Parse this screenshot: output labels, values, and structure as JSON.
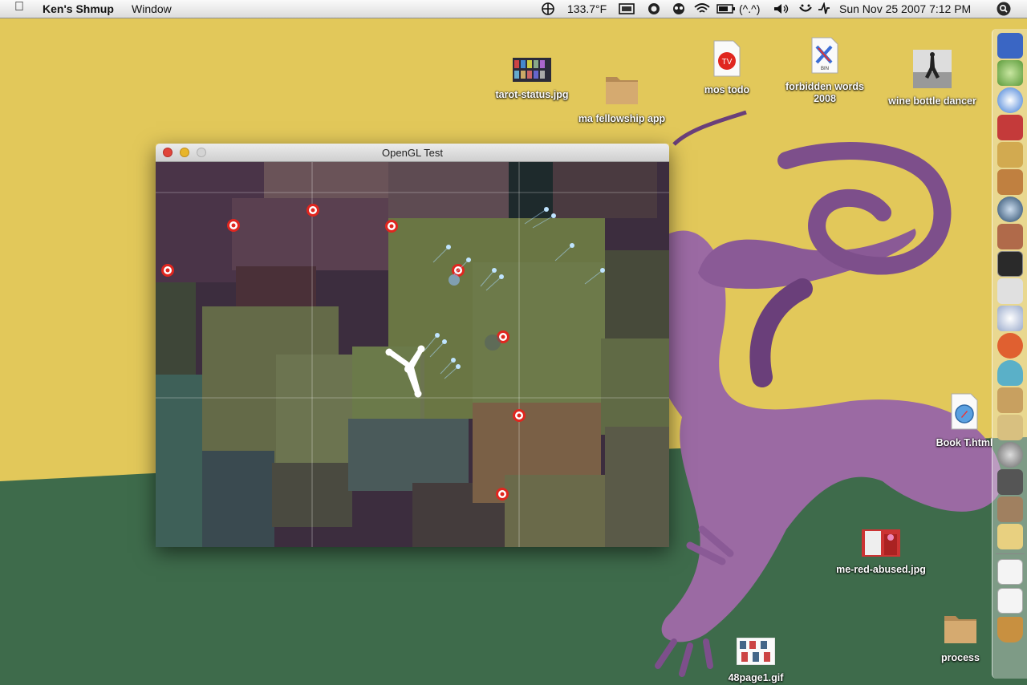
{
  "menubar": {
    "apple_label": "",
    "app_name": "Ken's Shmup",
    "menu_window": "Window",
    "temperature": "133.7°F",
    "emoticon": "(^.^)",
    "datetime": "Sun Nov 25 2007  7:12 PM"
  },
  "desktop": {
    "icons": [
      {
        "name": "tarot-status.jpg"
      },
      {
        "name": "ma fellowship app"
      },
      {
        "name": "mos todo"
      },
      {
        "name": "forbidden words 2008"
      },
      {
        "name": "wine bottle dancer"
      },
      {
        "name": "Book T.html"
      },
      {
        "name": "me-red-abused.jpg"
      },
      {
        "name": "process"
      },
      {
        "name": "48page1.gif"
      }
    ]
  },
  "window": {
    "title": "OpenGL Test"
  },
  "colors": {
    "wall_yellow": "#e2c85a",
    "wall_green": "#3e6b4b",
    "dragon_purple": "#9b6aa3",
    "target_red": "#e0261f"
  }
}
